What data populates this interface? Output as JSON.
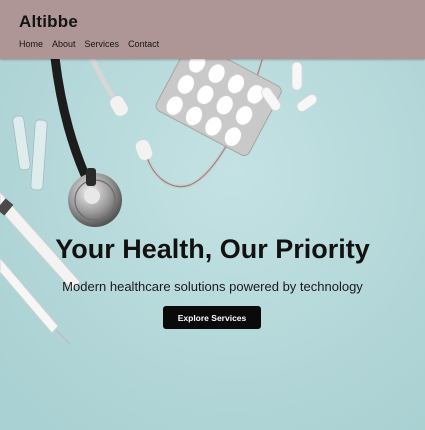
{
  "header": {
    "brand": "Altibbe",
    "nav": [
      "Home",
      "About",
      "Services",
      "Contact"
    ]
  },
  "hero": {
    "title": "Your Health, Our Priority",
    "subtitle": "Modern healthcare solutions powered by technology",
    "cta_label": "Explore Services"
  },
  "colors": {
    "header_bg": "#ae9696",
    "hero_bg": "#b3d6d8",
    "button_bg": "#0a0a0a",
    "button_text": "#ffffff"
  },
  "icons": [
    "stethoscope-image",
    "pill-blister-image",
    "thermometer-image",
    "syringe-image",
    "ampoule-image"
  ]
}
